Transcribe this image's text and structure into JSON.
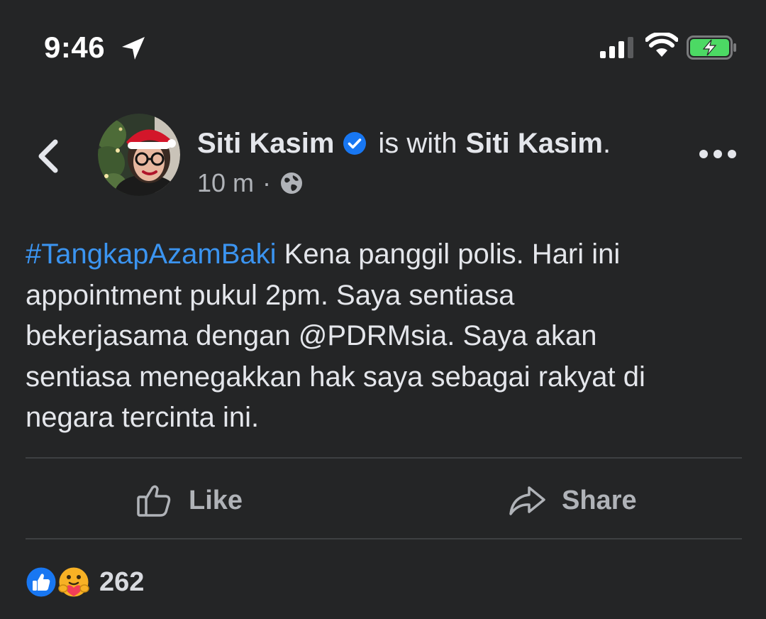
{
  "status_bar": {
    "time": "9:46",
    "location_icon": "location-arrow-icon",
    "signal_icon": "cellular-signal-icon",
    "wifi_icon": "wifi-icon",
    "battery_icon": "battery-charging-icon",
    "battery_color": "#4cd964"
  },
  "post": {
    "author": "Siti Kasim",
    "verified_icon": "verified-badge-icon",
    "with_text": "is with",
    "tagged_name": "Siti Kasim",
    "tagged_suffix": ".",
    "timestamp": "10 m",
    "separator": "·",
    "privacy_icon": "globe-icon",
    "hashtag": "#TangkapAzamBaki",
    "text_line1_rest": " Kena panggil polis. Hari ini",
    "text_line2": "appointment pukul 2pm. Saya sentiasa",
    "text_line3": "bekerjasama dengan @PDRMsia. Saya akan",
    "text_line4": "sentiasa menegakkan hak saya sebagai rakyat di",
    "text_line5": "negara tercinta ini."
  },
  "actions": {
    "like_label": "Like",
    "share_label": "Share"
  },
  "reactions": {
    "count": "262",
    "icons": [
      "like-reaction-icon",
      "care-reaction-icon"
    ]
  },
  "colors": {
    "background": "#242526",
    "hashtag": "#3b94f0",
    "verified": "#1877f2",
    "secondary_text": "#b0b3b8"
  }
}
